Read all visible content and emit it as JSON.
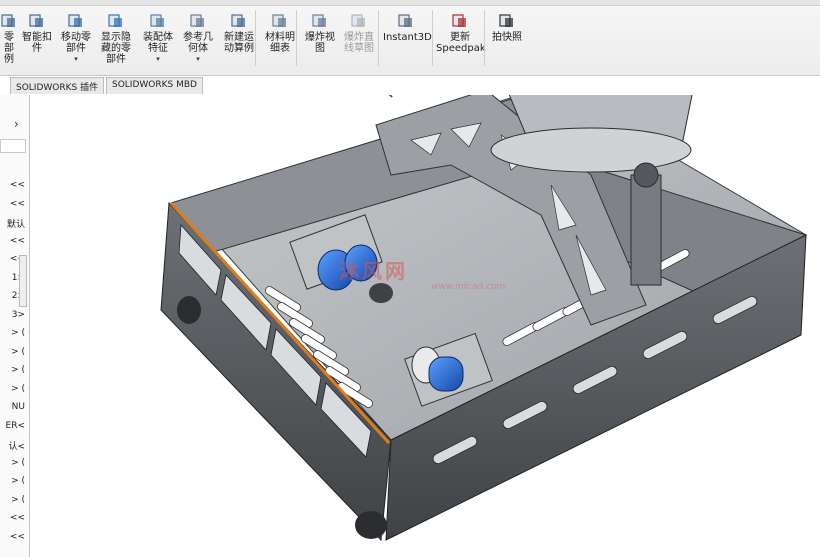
{
  "ribbon": {
    "buttons": [
      {
        "name": "linear-pattern",
        "label": "零部\n例",
        "icon": "pattern-icon",
        "caret": ""
      },
      {
        "name": "smart-fasteners",
        "label": "智能扣\n件",
        "icon": "fastener-icon",
        "caret": ""
      },
      {
        "name": "move-component",
        "label": "移动零\n部件",
        "icon": "move-component-icon",
        "caret": "▾"
      },
      {
        "name": "show-hidden-components",
        "label": "显示隐\n藏的零\n部件",
        "icon": "show-hidden-icon",
        "caret": ""
      },
      {
        "name": "assembly-features",
        "label": "装配体\n特征",
        "icon": "assembly-feature-icon",
        "caret": "▾"
      },
      {
        "name": "reference-geometry",
        "label": "参考几\n何体",
        "icon": "reference-geometry-icon",
        "caret": "▾"
      },
      {
        "name": "new-motion-study",
        "label": "新建运\n动算例",
        "icon": "motion-study-icon",
        "caret": ""
      },
      {
        "name": "bill-of-materials",
        "label": "材料明\n细表",
        "icon": "bom-icon",
        "caret": ""
      },
      {
        "name": "exploded-view",
        "label": "爆炸视\n图",
        "icon": "exploded-view-icon",
        "caret": ""
      },
      {
        "name": "explode-line-sketch",
        "label": "爆炸直\n线草图",
        "icon": "explode-line-icon",
        "caret": "",
        "disabled": true
      },
      {
        "name": "instant3d",
        "label": "Instant3D",
        "icon": "instant3d-icon",
        "caret": ""
      },
      {
        "name": "update-speedpak",
        "label": "更新\nSpeedpak",
        "icon": "speedpak-icon",
        "caret": ""
      },
      {
        "name": "take-snapshot",
        "label": "拍快照",
        "icon": "camera-icon",
        "caret": ""
      }
    ]
  },
  "tabs": [
    "SOLIDWORKS 插件",
    "SOLIDWORKS MBD"
  ],
  "left_panel": {
    "items": [
      "<<",
      "<<",
      "默认",
      "<<",
      "<<",
      "1>",
      "2>",
      "3>",
      "> (",
      "> (",
      "> (",
      "> (",
      "NU",
      "ER<",
      "认<",
      "> (",
      "> (",
      "> (",
      "<<",
      "<<"
    ]
  },
  "viewport": {
    "watermark": "沐风网",
    "watermark_sub": "www.mfcad.com",
    "hud_icons": [
      "zoom-fit-icon",
      "zoom-area-icon",
      "previous-view-icon",
      "section-view-icon",
      "view-orientation-icon",
      "display-style-icon",
      "hide-show-icon",
      "edit-appearance-icon",
      "apply-scene-icon",
      "view-settings-icon"
    ]
  },
  "colors": {
    "ribbon_bg": "#eeeeee",
    "part_dark": "#5e6266",
    "part_light": "#c9cccf",
    "motor_blue": "#1f6fd6",
    "edge_highlight": "#e07b1a"
  }
}
